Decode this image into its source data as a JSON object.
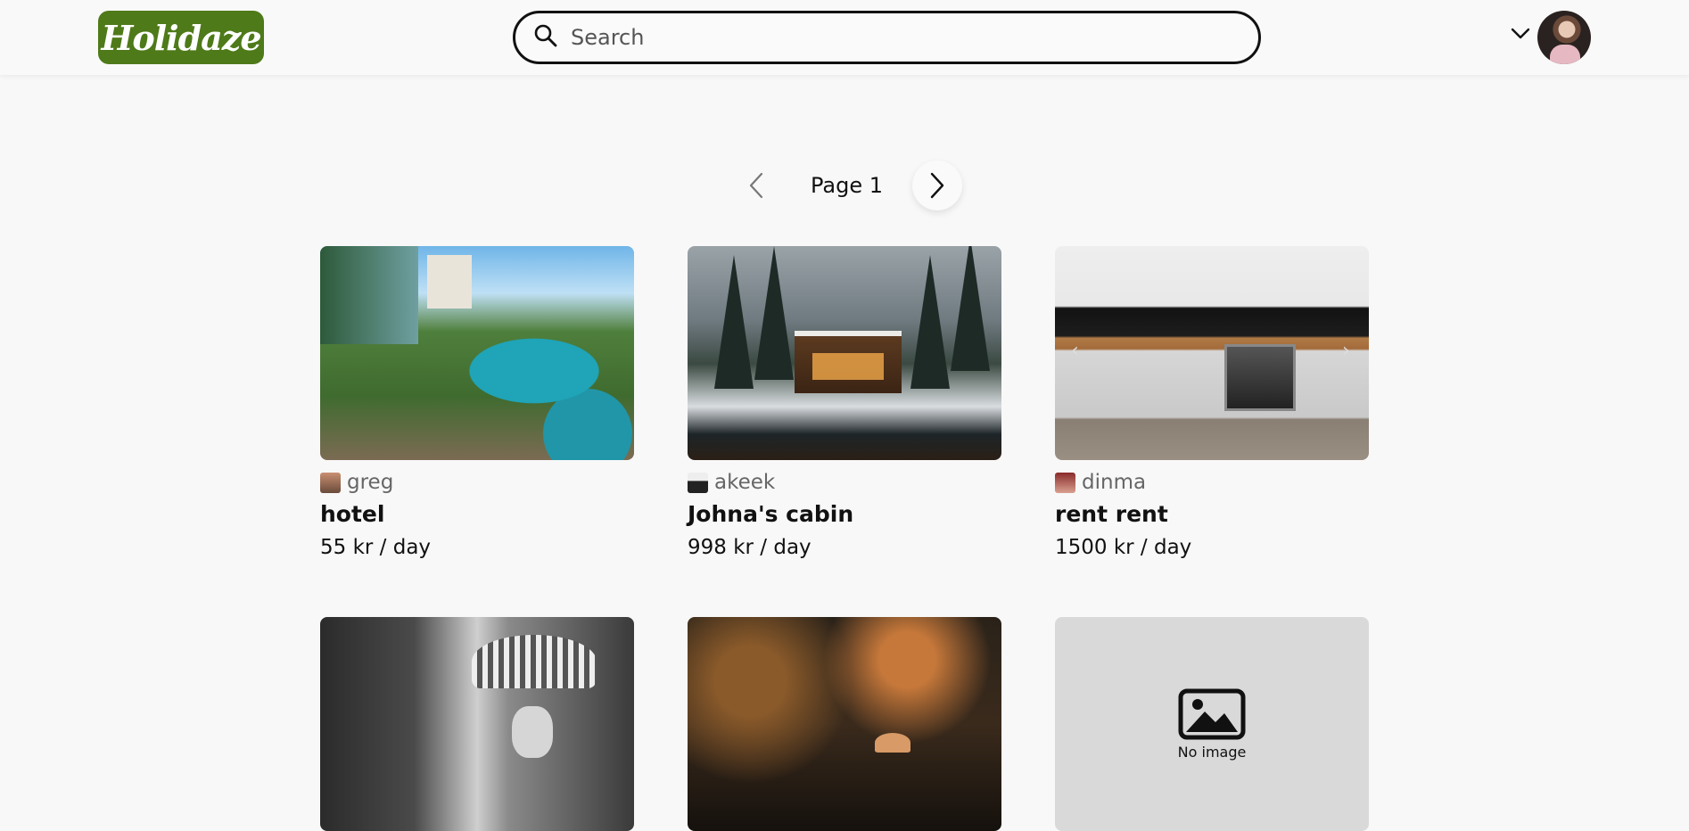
{
  "header": {
    "logo_text": "Holidaze",
    "search_placeholder": "Search",
    "brand_color": "#4e7a19"
  },
  "pager": {
    "label": "Page 1"
  },
  "cards": [
    {
      "owner": "greg",
      "title": "hotel",
      "price": "55 kr / day"
    },
    {
      "owner": "akeek",
      "title": "Johna's cabin",
      "price": "998 kr / day"
    },
    {
      "owner": "dinma",
      "title": "rent rent",
      "price": "1500 kr / day"
    },
    {
      "owner": "",
      "title": "",
      "price": ""
    },
    {
      "owner": "",
      "title": "",
      "price": ""
    },
    {
      "owner": "",
      "title": "",
      "price": "",
      "placeholder": "No image"
    }
  ],
  "icons": {
    "search": "search-icon",
    "menu": "chevron-down-icon",
    "prev": "chevron-left-icon",
    "next": "chevron-right-icon",
    "no_image": "image-placeholder-icon"
  }
}
